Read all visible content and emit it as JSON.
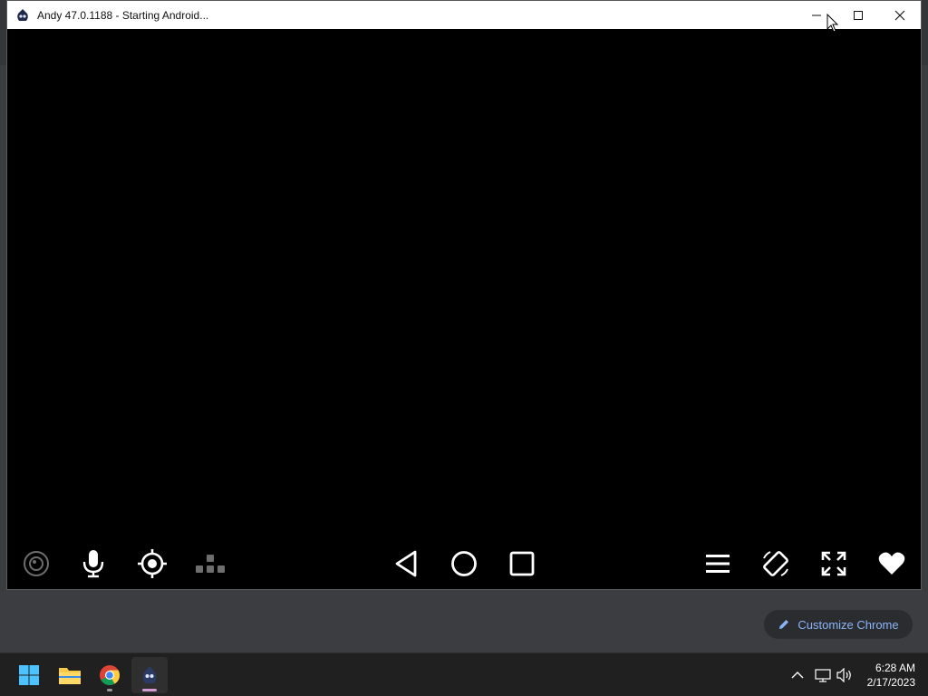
{
  "window": {
    "title": "Andy 47.0.1188 - Starting Android...",
    "minimize_label": "Minimize",
    "maximize_label": "Maximize",
    "close_label": "Close"
  },
  "navbar": {
    "left_icons": [
      "camera-icon",
      "microphone-icon",
      "location-target-icon",
      "keymap-icon"
    ],
    "center_icons": [
      "back-icon",
      "home-icon",
      "recents-icon"
    ],
    "right_icons": [
      "menu-icon",
      "rotate-icon",
      "fullscreen-icon",
      "heart-icon"
    ]
  },
  "chrome": {
    "customize_label": "Customize Chrome",
    "accent": "#8ab4f8"
  },
  "taskbar": {
    "apps": [
      "windows-start-icon",
      "file-explorer-icon",
      "chrome-icon",
      "andy-icon"
    ],
    "tray_icons": [
      "chevron-up-icon",
      "network-icon",
      "volume-icon"
    ],
    "time": "6:28 AM",
    "date": "2/17/2023"
  }
}
